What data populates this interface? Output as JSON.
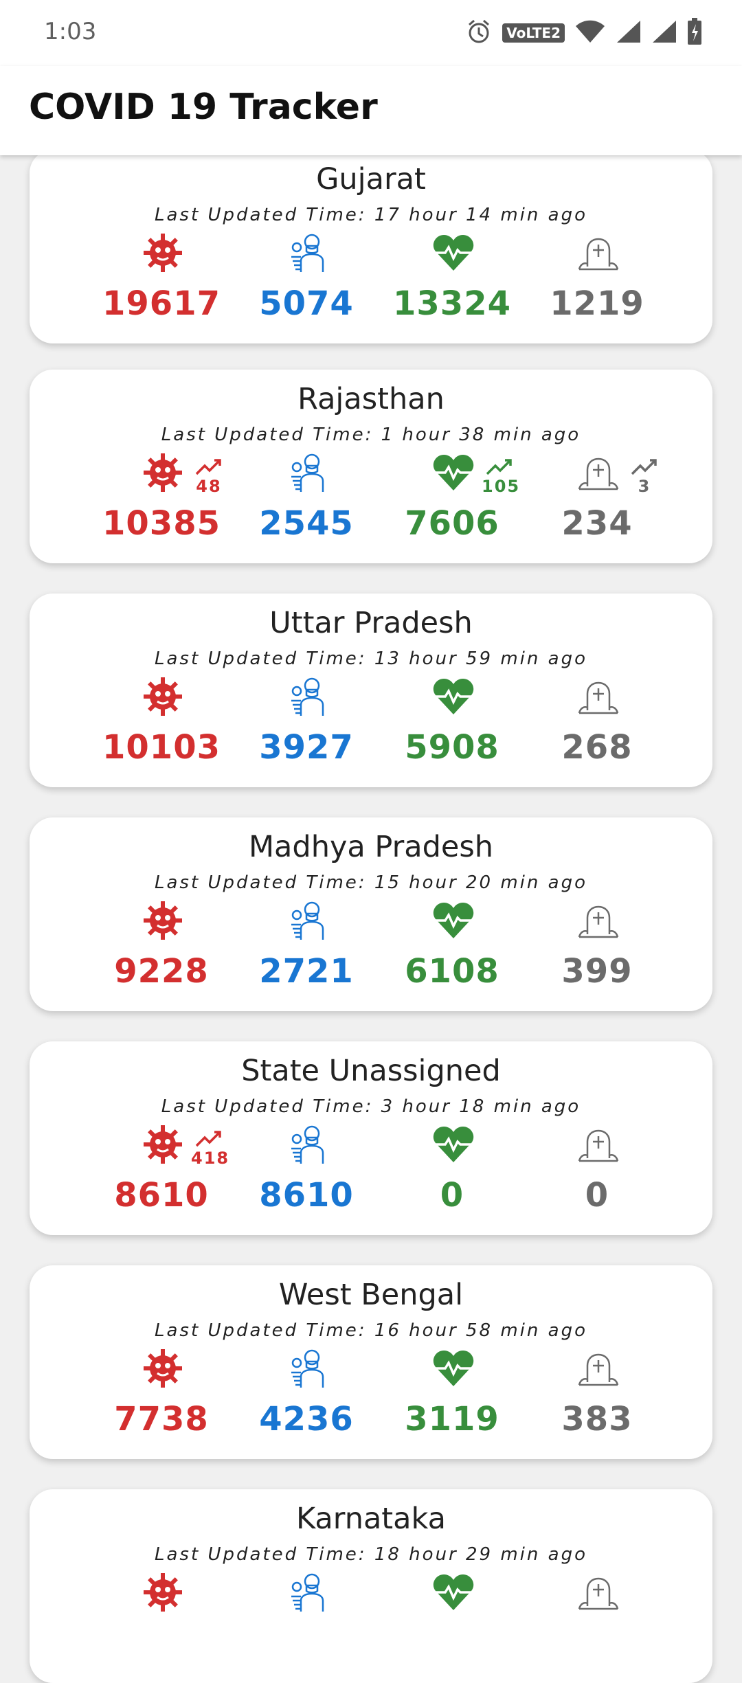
{
  "status_bar": {
    "time": "1:03",
    "volte": "VoLTE2"
  },
  "app_bar": {
    "title": "COVID 19 Tracker"
  },
  "updated_prefix": "Last Updated Time: ",
  "colors": {
    "confirmed": "#d32f2f",
    "active": "#1976d2",
    "recovered": "#388e3c",
    "deceased": "#6b6b6b"
  },
  "stat_icons": [
    "virus-icon",
    "patient-mask-icon",
    "heart-pulse-icon",
    "grave-icon"
  ],
  "states": [
    {
      "name": "Gujarat",
      "updated": "17 hour 14 min ago",
      "confirmed": "19617",
      "active": "5074",
      "recovered": "13324",
      "deceased": "1219",
      "d_confirmed": "",
      "d_recovered": "",
      "d_deceased": ""
    },
    {
      "name": "Rajasthan",
      "updated": "1 hour 38 min ago",
      "confirmed": "10385",
      "active": "2545",
      "recovered": "7606",
      "deceased": "234",
      "d_confirmed": "48",
      "d_recovered": "105",
      "d_deceased": "3"
    },
    {
      "name": "Uttar Pradesh",
      "updated": "13 hour 59 min ago",
      "confirmed": "10103",
      "active": "3927",
      "recovered": "5908",
      "deceased": "268",
      "d_confirmed": "",
      "d_recovered": "",
      "d_deceased": ""
    },
    {
      "name": "Madhya Pradesh",
      "updated": "15 hour 20 min ago",
      "confirmed": "9228",
      "active": "2721",
      "recovered": "6108",
      "deceased": "399",
      "d_confirmed": "",
      "d_recovered": "",
      "d_deceased": ""
    },
    {
      "name": "State Unassigned",
      "updated": "3 hour 18 min ago",
      "confirmed": "8610",
      "active": "8610",
      "recovered": "0",
      "deceased": "0",
      "d_confirmed": "418",
      "d_recovered": "",
      "d_deceased": ""
    },
    {
      "name": "West Bengal",
      "updated": "16 hour 58 min ago",
      "confirmed": "7738",
      "active": "4236",
      "recovered": "3119",
      "deceased": "383",
      "d_confirmed": "",
      "d_recovered": "",
      "d_deceased": ""
    },
    {
      "name": "Karnataka",
      "updated": "18 hour 29 min ago",
      "confirmed": "",
      "active": "",
      "recovered": "",
      "deceased": "",
      "d_confirmed": "",
      "d_recovered": "",
      "d_deceased": ""
    }
  ]
}
